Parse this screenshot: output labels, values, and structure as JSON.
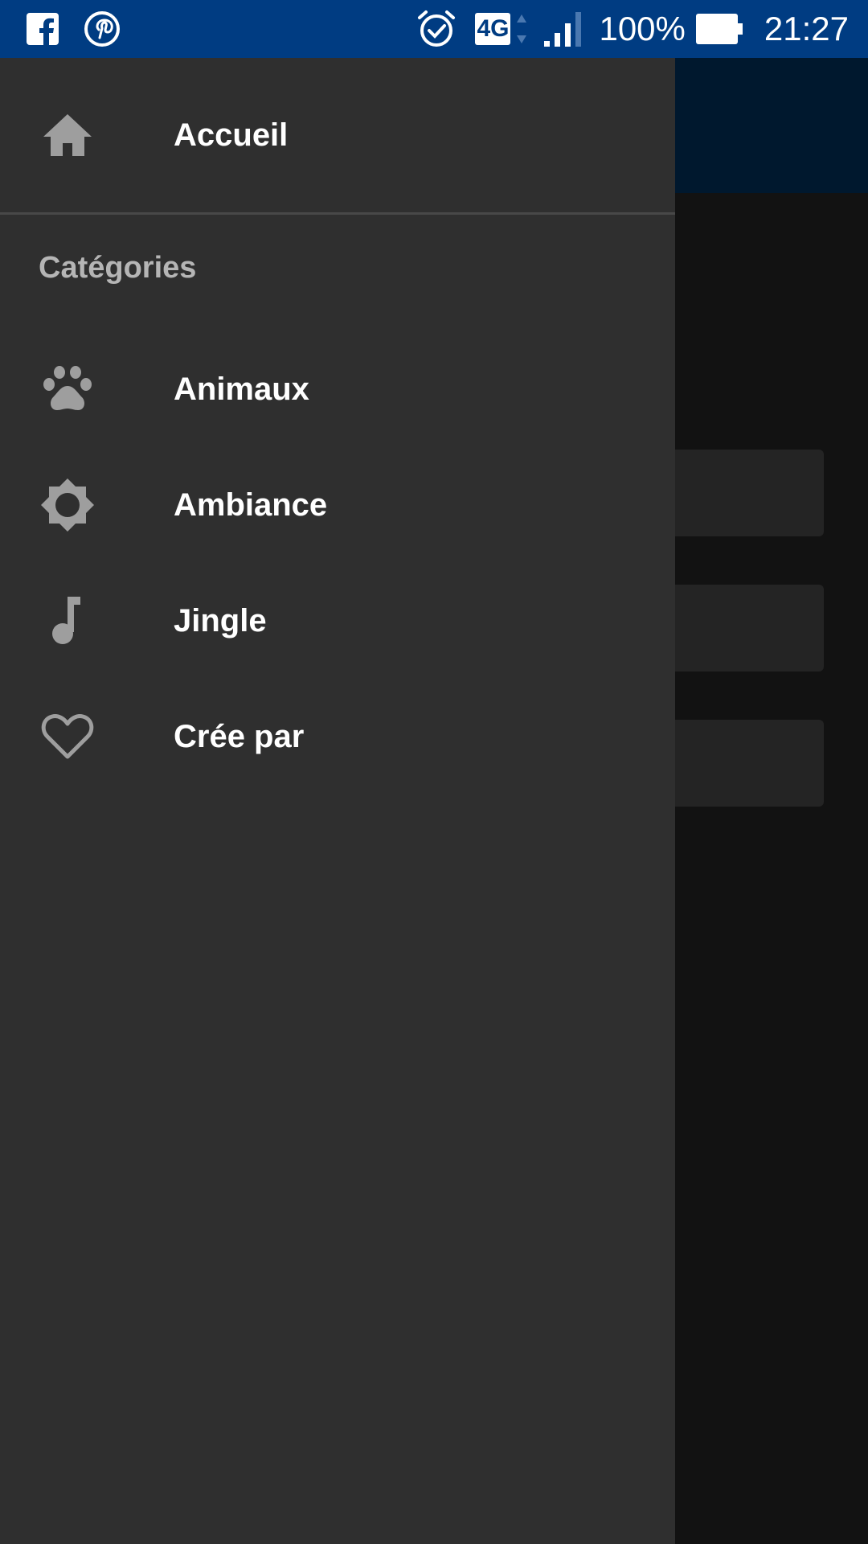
{
  "status_bar": {
    "left_icons": [
      "facebook-icon",
      "pinterest-icon"
    ],
    "network_label": "4G",
    "battery_text": "100%",
    "time": "21:27",
    "background_color": "#003c82"
  },
  "drawer": {
    "home": {
      "label": "Accueil",
      "icon": "home-icon"
    },
    "section_header": "Catégories",
    "items": [
      {
        "label": "Animaux",
        "icon": "paw-icon"
      },
      {
        "label": "Ambiance",
        "icon": "brightness-icon"
      },
      {
        "label": "Jingle",
        "icon": "music-note-icon"
      },
      {
        "label": "Crée par",
        "icon": "heart-outline-icon"
      }
    ],
    "background_color": "#2f2f2f"
  }
}
